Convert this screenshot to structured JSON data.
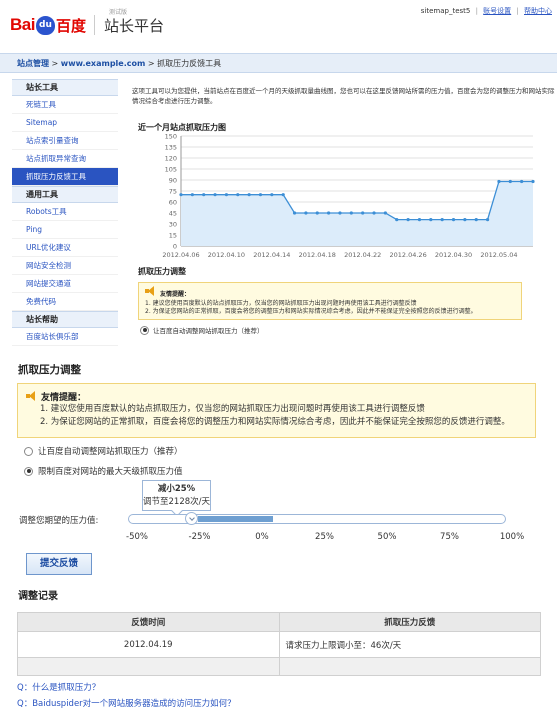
{
  "header": {
    "logo_bai": "Bai",
    "logo_du": "du",
    "logo_cn": "百度",
    "beta": "测试版",
    "product": "站长平台",
    "user": "sitemap_test5",
    "separator": "|",
    "account_settings": "账号设置",
    "help_center": "帮助中心"
  },
  "breadcrumb": {
    "root": "站点管理",
    "site": "www.example.com",
    "arrow": ">",
    "current": "抓取压力反馈工具"
  },
  "sidebar": {
    "groups": [
      {
        "title": "站长工具",
        "items": [
          "死链工具",
          "Sitemap",
          "站点索引量查询",
          "站点抓取异常查询",
          "抓取压力反馈工具"
        ]
      },
      {
        "title": "通用工具",
        "items": [
          "Robots工具",
          "Ping",
          "URL优化建议",
          "网站安全检测",
          "网站提交通道",
          "免费代码"
        ]
      },
      {
        "title": "站长帮助",
        "items": [
          "百度站长俱乐部"
        ]
      }
    ],
    "active": "抓取压力反馈工具"
  },
  "intro": {
    "text": "这项工具可以为您提供，当前站点在百度近一个月的天级抓取量曲线图，您也可以在这里反馈网站所需的压力值，百度会为您的调整压力和网站实际情况综合考虑进行压力调整。"
  },
  "chart_data": {
    "type": "area",
    "title": "近一个月站点抓取压力图",
    "x_ticks": [
      "2012.04.06",
      "2012.04.10",
      "2012.04.14",
      "2012.04.18",
      "2012.04.22",
      "2012.04.26",
      "2012.04.30",
      "2012.05.04"
    ],
    "y_ticks": [
      0,
      15,
      30,
      45,
      60,
      75,
      90,
      105,
      120,
      135,
      150
    ],
    "ylim": [
      0,
      150
    ],
    "x_start": "2012.04.05",
    "x_end": "2012.05.07",
    "values": [
      70,
      70,
      70,
      70,
      70,
      70,
      70,
      70,
      70,
      70,
      45,
      45,
      45,
      45,
      45,
      45,
      45,
      45,
      45,
      36,
      36,
      36,
      36,
      36,
      36,
      36,
      36,
      36,
      88,
      88,
      88,
      88,
      88,
      88,
      88,
      88,
      88,
      114,
      114,
      114,
      114,
      114
    ],
    "dates": [
      "2012.04.06",
      "2012.04.07",
      "2012.04.08",
      "2012.04.09",
      "2012.04.10",
      "2012.04.11",
      "2012.04.12",
      "2012.04.13",
      "2012.04.14",
      "2012.04.15",
      "2012.04.16",
      "2012.04.17",
      "2012.04.18",
      "2012.04.19",
      "2012.04.20",
      "2012.04.21",
      "2012.04.22",
      "2012.04.23",
      "2012.04.24",
      "2012.04.25",
      "2012.04.26",
      "2012.04.27",
      "2012.04.28",
      "2012.04.29",
      "2012.04.30",
      "2012.05.01",
      "2012.05.02",
      "2012.05.03",
      "2012.05.04",
      "2012.05.05",
      "2012.05.06",
      "2012.05.07"
    ],
    "grid": true,
    "colors": {
      "line": "#3d8fd6",
      "fill": "#dcecfa",
      "grid": "#e2e2e2",
      "axis": "#999999"
    }
  },
  "mini_adjust": {
    "title": "抓取压力调整",
    "tip_title": "友情提醒：",
    "tip_lines": [
      "1. 建议您使用百度默认的站点抓取压力，仅当您的网站抓取压力出现问题时再使用该工具进行调整反馈",
      "2. 为保证您网站的正常抓取，百度会将您的调整压力和网站实际情况综合考虑，因此并不能保证完全按照您的反馈进行调整。"
    ],
    "radio_label": "让百度自动调整网站抓取压力（推荐）"
  },
  "adjust": {
    "title": "抓取压力调整",
    "tip_title": "友情提醒：",
    "tip_lines": [
      "1. 建议您使用百度默认的站点抓取压力，仅当您的网站抓取压力出现问题时再使用该工具进行调整反馈",
      "2. 为保证您网站的正常抓取，百度会将您的调整压力和网站实际情况综合考虑，因此并不能保证完全按照您的反馈进行调整。"
    ],
    "option_auto": "让百度自动调整网站抓取压力（推荐）",
    "option_limit": "限制百度对网站的最大天级抓取压力值",
    "selected": "option_limit",
    "bubble_line1": "减小25%",
    "bubble_line2": "调节至2128次/天",
    "slider_label": "调整您期望的压力值:",
    "slider_value_percent": -25,
    "ticks": [
      "-50%",
      "-25%",
      "0%",
      "25%",
      "50%",
      "75%",
      "100%"
    ],
    "submit_label": "提交反馈"
  },
  "log": {
    "title": "调整记录",
    "headers": [
      "反馈时间",
      "抓取压力反馈"
    ],
    "rows": [
      [
        "2012.04.19",
        "请求压力上限调小至：46次/天"
      ]
    ]
  },
  "faq": [
    "Q：什么是抓取压力？",
    "Q：Baiduspider对一个网站服务器造成的访问压力如何？"
  ],
  "colors": {
    "accent": "#2a54c1",
    "brand_red": "#e10602",
    "tip_bg": "#fffbe0",
    "tip_border": "#f0d47a"
  }
}
